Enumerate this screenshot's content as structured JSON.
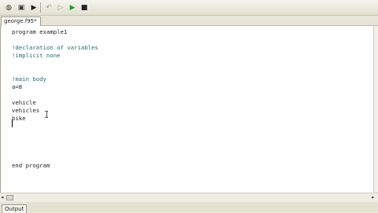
{
  "toolbar": {
    "buttons": [
      {
        "icon": "compile-icon",
        "glyph": "◍",
        "color": "#3a3a3a"
      },
      {
        "icon": "build-icon",
        "glyph": "▣",
        "color": "#3a3a3a"
      },
      {
        "icon": "run-icon",
        "glyph": "▶",
        "color": "#222222"
      },
      {
        "icon": "undo-icon",
        "glyph": "↶",
        "color": "#9a9a9a"
      },
      {
        "icon": "step-icon",
        "glyph": "▷",
        "color": "#9a9a9a"
      },
      {
        "icon": "debug-run-icon",
        "glyph": "▶",
        "color": "#1f9e2f"
      },
      {
        "icon": "stop-icon",
        "glyph": "■",
        "color": "#222222"
      }
    ]
  },
  "tab": {
    "label": "george.f95*"
  },
  "editor": {
    "lines": [
      {
        "text": "program example1",
        "type": "code"
      },
      {
        "text": "",
        "type": "code"
      },
      {
        "text": "!declaration of variables",
        "type": "comment"
      },
      {
        "text": "!implicit none",
        "type": "comment"
      },
      {
        "text": "",
        "type": "code"
      },
      {
        "text": "",
        "type": "code"
      },
      {
        "text": "!main body",
        "type": "comment"
      },
      {
        "text": "a=8",
        "type": "code"
      },
      {
        "text": "",
        "type": "code"
      },
      {
        "text": "vehicle",
        "type": "code"
      },
      {
        "text": "vehicles",
        "type": "code"
      },
      {
        "text": "bike",
        "type": "code"
      },
      {
        "text": "",
        "type": "code"
      },
      {
        "text": "",
        "type": "code"
      },
      {
        "text": "",
        "type": "code"
      },
      {
        "text": "",
        "type": "code"
      },
      {
        "text": "",
        "type": "code"
      },
      {
        "text": "end program",
        "type": "code"
      }
    ]
  },
  "output_panel": {
    "label": "Output"
  },
  "colors": {
    "comment": "#1f6e6e",
    "code": "#1e1e1e",
    "run_green": "#1f9e2f"
  }
}
